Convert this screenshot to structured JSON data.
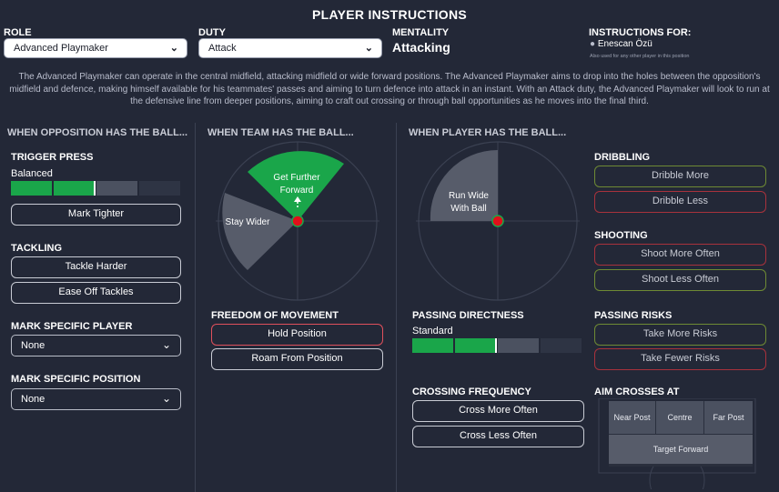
{
  "title": "PLAYER INSTRUCTIONS",
  "role": {
    "label": "ROLE",
    "value": "Advanced Playmaker"
  },
  "duty": {
    "label": "DUTY",
    "value": "Attack"
  },
  "mentality": {
    "label": "MENTALITY",
    "value": "Attacking"
  },
  "instructions_for": {
    "label": "INSTRUCTIONS FOR:",
    "player": "Enescan Özü",
    "note": "Also used for any other player in this position"
  },
  "description": "The Advanced Playmaker can operate in the central midfield, attacking midfield or wide forward positions. The Advanced Playmaker aims to drop into the holes between the opposition's midfield and defence, making himself available for his teammates' passes and aiming to turn defence into attack in an instant. With an Attack duty, the Advanced Playmaker will look to run at the defensive line from deeper positions, aiming to craft out crossing or through ball opportunities as he moves into the final third.",
  "opposition": {
    "header": "WHEN OPPOSITION HAS THE BALL...",
    "trigger_press": {
      "label": "TRIGGER PRESS",
      "value": "Balanced",
      "level": 0.5
    },
    "mark_tighter": "Mark Tighter",
    "tackling": {
      "label": "TACKLING",
      "harder": "Tackle Harder",
      "ease": "Ease Off Tackles"
    },
    "mark_player": {
      "label": "MARK SPECIFIC PLAYER",
      "value": "None"
    },
    "mark_position": {
      "label": "MARK SPECIFIC POSITION",
      "value": "None"
    }
  },
  "team": {
    "header": "WHEN TEAM HAS THE BALL...",
    "get_further_forward_l1": "Get Further",
    "get_further_forward_l2": "Forward",
    "stay_wider": "Stay Wider",
    "freedom": {
      "label": "FREEDOM OF MOVEMENT",
      "hold": "Hold Position",
      "roam": "Roam From Position"
    }
  },
  "player": {
    "header": "WHEN PLAYER HAS THE BALL...",
    "run_wide_l1": "Run Wide",
    "run_wide_l2": "With Ball",
    "passing": {
      "label": "PASSING DIRECTNESS",
      "value": "Standard",
      "level": 0.5
    },
    "crossing": {
      "label": "CROSSING FREQUENCY",
      "more": "Cross More Often",
      "less": "Cross Less Often"
    },
    "dribbling": {
      "label": "DRIBBLING",
      "more": "Dribble More",
      "less": "Dribble Less"
    },
    "shooting": {
      "label": "SHOOTING",
      "more": "Shoot More Often",
      "less": "Shoot Less Often"
    },
    "risks": {
      "label": "PASSING RISKS",
      "more": "Take More Risks",
      "fewer": "Take Fewer Risks"
    },
    "aim": {
      "label": "AIM CROSSES AT",
      "near": "Near Post",
      "centre": "Centre",
      "far": "Far Post",
      "target": "Target Forward"
    }
  },
  "colors": {
    "green": "#1aa64a",
    "red": "#e0505c",
    "accent_olive": "#7fa83a",
    "bg": "#232837"
  }
}
